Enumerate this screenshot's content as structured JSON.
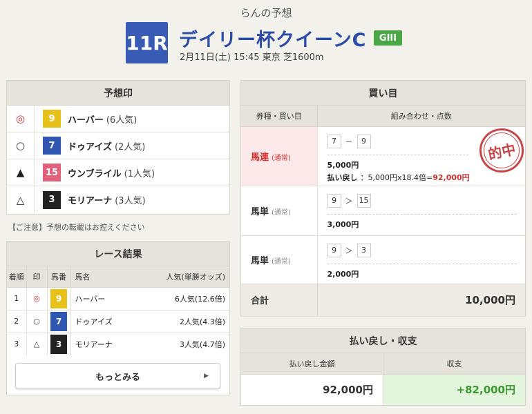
{
  "header": {
    "subtitle": "らんの予想",
    "race_number": "11R",
    "race_name": "デイリー杯クイーンC",
    "grade": "GIII",
    "race_info": "2月11日(土) 15:45 東京 芝1600m"
  },
  "prediction": {
    "title": "予想印",
    "rows": [
      {
        "mark": "◎",
        "num": "9",
        "name": "ハーバー",
        "pop": "(6人気)",
        "num_bg": "#e8c01a",
        "num_fg": "#ffffff",
        "mark_color": "#d63030"
      },
      {
        "mark": "○",
        "num": "7",
        "name": "ドゥアイズ",
        "pop": "(2人気)",
        "num_bg": "#2f56b0",
        "num_fg": "#ffffff",
        "mark_color": "#333333"
      },
      {
        "mark": "▲",
        "num": "15",
        "name": "ウンブライル",
        "pop": "(1人気)",
        "num_bg": "#e0617a",
        "num_fg": "#ffffff",
        "mark_color": "#222222"
      },
      {
        "mark": "△",
        "num": "3",
        "name": "モリアーナ",
        "pop": "(3人気)",
        "num_bg": "#222222",
        "num_fg": "#ffffff",
        "mark_color": "#333333"
      }
    ]
  },
  "notice": "【ご注意】予想の転載はお控えください",
  "results": {
    "title": "レース結果",
    "headers": [
      "着順",
      "印",
      "馬番",
      "馬名",
      "人気(単勝オッズ)"
    ],
    "rows": [
      {
        "rank": "1",
        "mark": "◎",
        "num": "9",
        "name": "ハーバー",
        "pop": "6人気(12.6倍)",
        "num_bg": "#e8c01a",
        "mark_color": "#d63030"
      },
      {
        "rank": "2",
        "mark": "○",
        "num": "7",
        "name": "ドゥアイズ",
        "pop": "2人気(4.3倍)",
        "num_bg": "#2f56b0",
        "mark_color": "#333333"
      },
      {
        "rank": "3",
        "mark": "△",
        "num": "3",
        "name": "モリアーナ",
        "pop": "3人気(4.7倍)",
        "num_bg": "#222222",
        "mark_color": "#333333"
      }
    ],
    "more_label": "もっとみる"
  },
  "buy": {
    "title": "買い目",
    "headers": [
      "券種・買い目",
      "組み合わせ・点数"
    ],
    "rows": [
      {
        "type": "馬連",
        "sub": "(通常)",
        "a": "7",
        "sep": "－",
        "b": "9",
        "amount": "5,000円",
        "payout_label": "払い戻し",
        "payout_calc": "：5,000円x18.4倍=",
        "payout_value": "92,000円",
        "hit": true,
        "stamp": "的中"
      },
      {
        "type": "馬単",
        "sub": "(通常)",
        "a": "9",
        "sep": "＞",
        "b": "15",
        "amount": "3,000円",
        "hit": false
      },
      {
        "type": "馬単",
        "sub": "(通常)",
        "a": "9",
        "sep": "＞",
        "b": "3",
        "amount": "2,000円",
        "hit": false
      }
    ],
    "total_label": "合計",
    "total_value": "10,000円"
  },
  "payout": {
    "title": "払い戻し・収支",
    "headers": [
      "払い戻し金額",
      "収支"
    ],
    "refund": "92,000円",
    "balance": "+82,000円"
  },
  "colors": {
    "accent_blue": "#3a5bb5",
    "grade_green": "#49a845",
    "hit_red": "#d63030",
    "profit_green": "#3a9a2f"
  }
}
